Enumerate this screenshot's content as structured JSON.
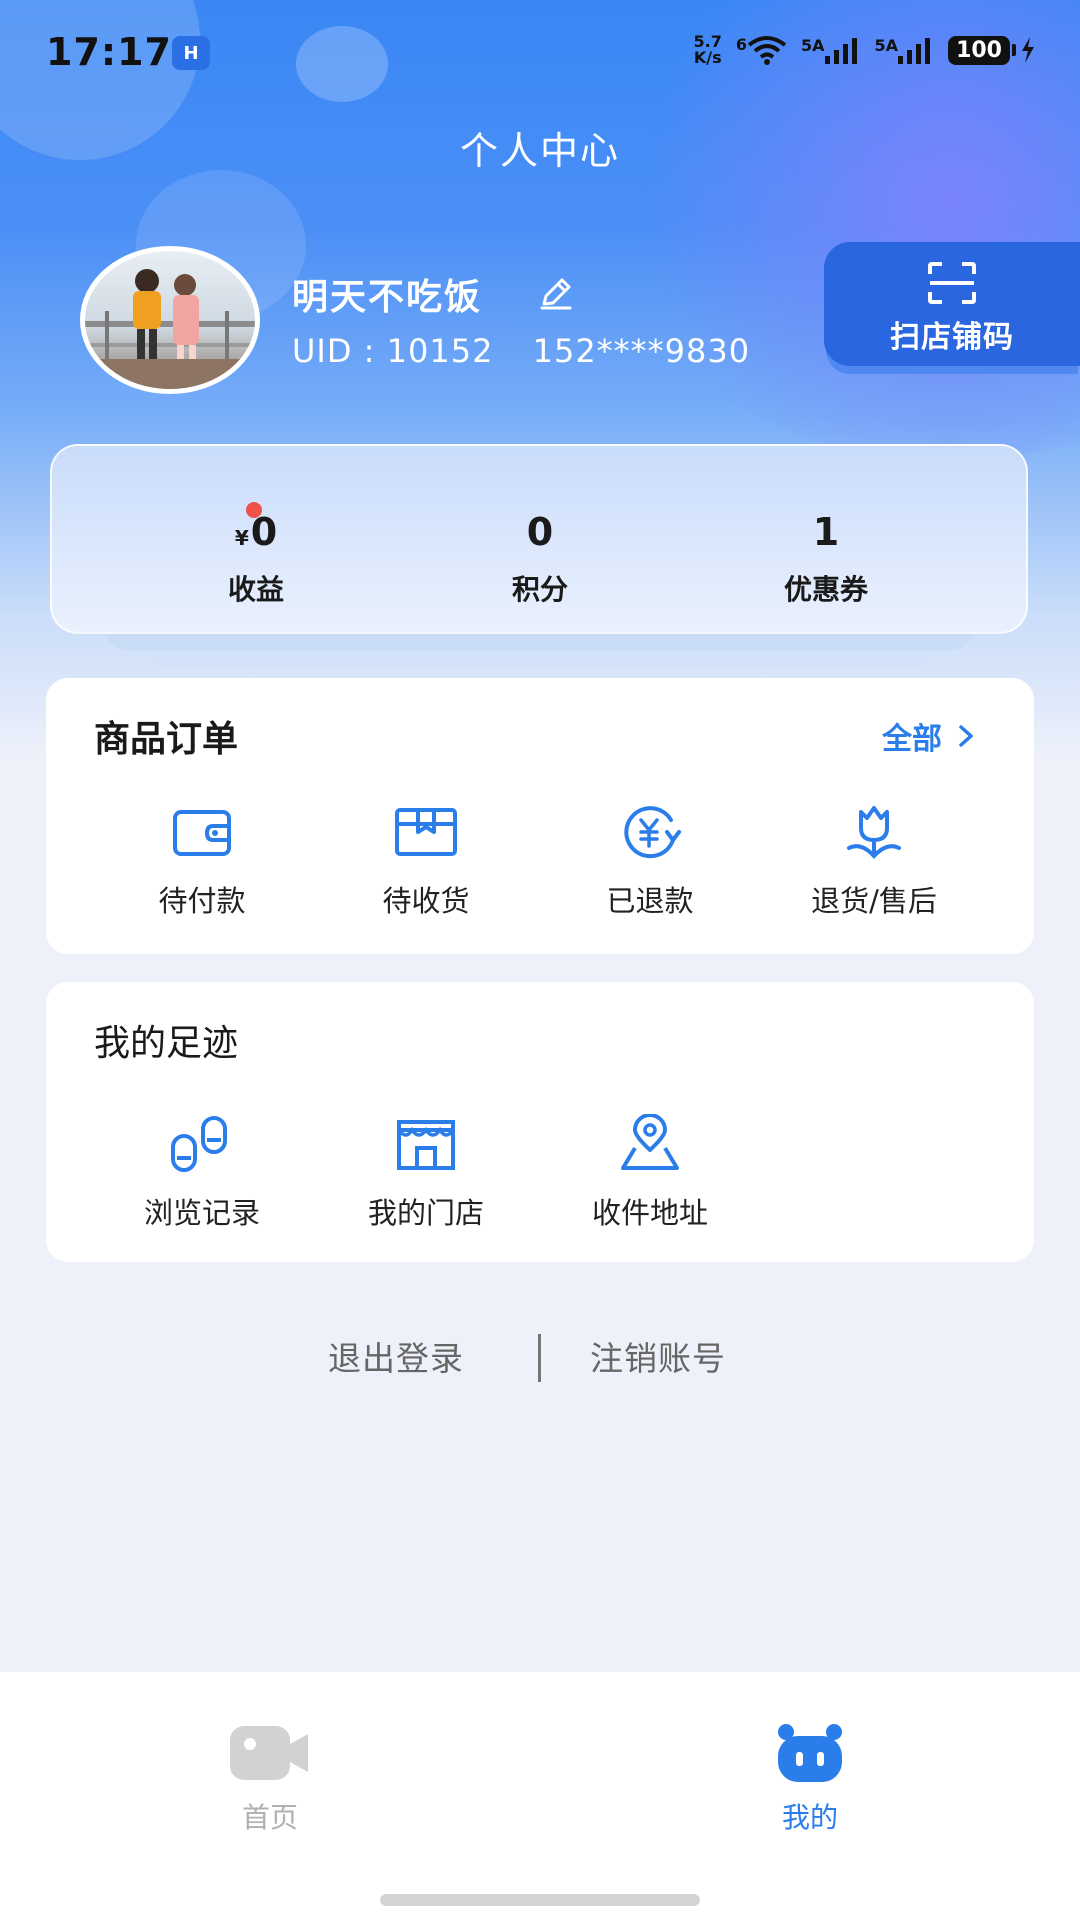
{
  "status_bar": {
    "time": "17:17",
    "hd_label": "H",
    "net_speed_value": "5.7",
    "net_speed_unit": "K/s",
    "wifi_label": "6",
    "signal1_label": "5A",
    "signal2_label": "5A",
    "battery": "100"
  },
  "header": {
    "title": "个人中心"
  },
  "profile": {
    "username": "明天不吃饭",
    "uid": "UID : 10152",
    "phone": "152****9830",
    "scan_button_label": "扫店铺码"
  },
  "stats": [
    {
      "prefix": "¥",
      "value": "0",
      "label": "收益",
      "has_dot": true
    },
    {
      "prefix": "",
      "value": "0",
      "label": "积分",
      "has_dot": false
    },
    {
      "prefix": "",
      "value": "1",
      "label": "优惠券",
      "has_dot": false
    }
  ],
  "orders": {
    "title": "商品订单",
    "all_label": "全部",
    "items": [
      {
        "label": "待付款",
        "icon": "wallet-icon"
      },
      {
        "label": "待收货",
        "icon": "package-icon"
      },
      {
        "label": "已退款",
        "icon": "refund-icon"
      },
      {
        "label": "退货/售后",
        "icon": "after-sale-icon"
      }
    ]
  },
  "footprints": {
    "title": "我的足迹",
    "items": [
      {
        "label": "浏览记录",
        "icon": "footprints-icon"
      },
      {
        "label": "我的门店",
        "icon": "store-icon"
      },
      {
        "label": "收件地址",
        "icon": "location-icon"
      }
    ]
  },
  "actions": {
    "logout": "退出登录",
    "delete_account": "注销账号"
  },
  "tabbar": {
    "items": [
      {
        "label": "首页",
        "icon": "video-camera-icon",
        "active": false
      },
      {
        "label": "我的",
        "icon": "robot-face-icon",
        "active": true
      }
    ]
  },
  "colors": {
    "accent": "#2b7de9",
    "header_blue": "#3a87f5",
    "badge_red": "#f0524a",
    "inactive_tab": "#b0b0b0"
  }
}
